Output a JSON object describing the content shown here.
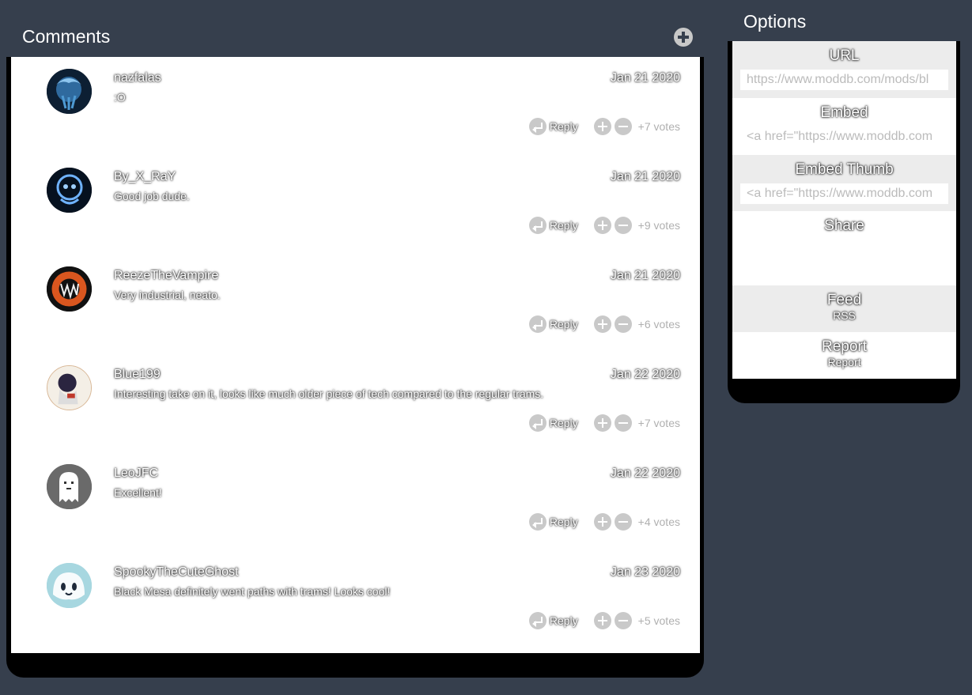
{
  "comments": {
    "title": "Comments",
    "reply_label": "Reply",
    "items": [
      {
        "username": "nazfalas",
        "date": "Jan 21 2020",
        "text": ":O",
        "votes": "+7 votes"
      },
      {
        "username": "By_X_RaY",
        "date": "Jan 21 2020",
        "text": "Good job dude.",
        "votes": "+9 votes"
      },
      {
        "username": "ReezeTheVampire",
        "date": "Jan 21 2020",
        "text": "Very industrial, neato.",
        "votes": "+6 votes"
      },
      {
        "username": "Blue199",
        "date": "Jan 22 2020",
        "text": "Interesting take on it, looks like much older piece of tech compared to the regular trams.",
        "votes": "+7 votes"
      },
      {
        "username": "LeoJFC",
        "date": "Jan 22 2020",
        "text": "Excellent!",
        "votes": "+4 votes"
      },
      {
        "username": "SpookyTheCuteGhost",
        "date": "Jan 23 2020",
        "text": "Black Mesa definitely went paths with trams! Looks cool!",
        "votes": "+5 votes"
      }
    ]
  },
  "options": {
    "title": "Options",
    "url_label": "URL",
    "url_value": "https://www.moddb.com/mods/bl",
    "embed_label": "Embed",
    "embed_value": "<a href=\"https://www.moddb.com",
    "embed_thumb_label": "Embed Thumb",
    "embed_thumb_value": "<a href=\"https://www.moddb.com",
    "share_label": "Share",
    "feed_label": "Feed",
    "feed_link": "RSS",
    "report_label": "Report",
    "report_link": "Report"
  },
  "colors": {
    "background": "#363f4d",
    "row_shade": "#ececec",
    "control_grey": "#c9c9c9"
  }
}
